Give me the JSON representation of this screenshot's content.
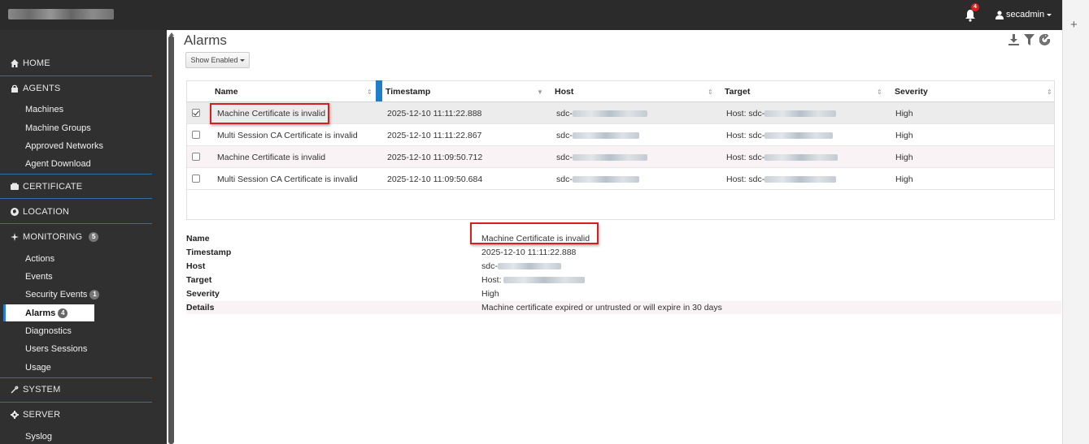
{
  "topbar": {
    "notification_count": "4",
    "username": "secadmin"
  },
  "sidebar": {
    "home": "HOME",
    "agents": "AGENTS",
    "agents_items": [
      "Machines",
      "Machine Groups",
      "Approved Networks",
      "Agent Download"
    ],
    "certificate": "CERTIFICATE",
    "location": "LOCATION",
    "monitoring": "MONITORING",
    "monitoring_count": "5",
    "monitoring_items": [
      "Actions",
      "Events"
    ],
    "security_events": "Security Events",
    "security_events_count": "1",
    "alarms": "Alarms",
    "alarms_count": "4",
    "monitoring_items_after": [
      "Diagnostics",
      "Users Sessions",
      "Usage"
    ],
    "system": "SYSTEM",
    "server": "SERVER",
    "server_items": [
      "Syslog"
    ]
  },
  "page": {
    "title": "Alarms",
    "show_button": "Show Enabled"
  },
  "table": {
    "columns": [
      "Name",
      "Timestamp",
      "Host",
      "Target",
      "Severity"
    ],
    "rows": [
      {
        "checked": true,
        "name": "Machine Certificate is invalid",
        "timestamp": "2025-12-10 11:11:22.888",
        "host": "sdc-",
        "target": "Host: sdc-",
        "severity": "High"
      },
      {
        "checked": false,
        "name": "Multi Session CA Certificate is invalid",
        "timestamp": "2025-12-10 11:11:22.867",
        "host": "sdc-",
        "target": "Host: sdc-",
        "severity": "High"
      },
      {
        "checked": false,
        "name": "Machine Certificate is invalid",
        "timestamp": "2025-12-10 11:09:50.712",
        "host": "sdc-",
        "target": "Host: sdc-",
        "severity": "High"
      },
      {
        "checked": false,
        "name": "Multi Session CA Certificate is invalid",
        "timestamp": "2025-12-10 11:09:50.684",
        "host": "sdc-",
        "target": "Host: sdc-",
        "severity": "High"
      }
    ]
  },
  "details": {
    "labels": [
      "Name",
      "Timestamp",
      "Host",
      "Target",
      "Severity",
      "Details"
    ],
    "name": "Machine Certificate is invalid",
    "timestamp": "2025-12-10 11:11:22.888",
    "host": "sdc-",
    "target": "Host:",
    "severity": "High",
    "details": "Machine certificate expired or untrusted or will expire in 30 days"
  },
  "colors": {
    "topbar": "#2b2b2b",
    "sidebar": "#303030",
    "accent": "#1e7ec8",
    "highlight_box": "#d21f1f"
  },
  "icons": [
    "bell-icon",
    "user-icon",
    "home-icon",
    "lock-icon",
    "certificate-icon",
    "globe-icon",
    "monitoring-icon",
    "wrench-icon",
    "gear-icon",
    "download-icon",
    "filter-icon",
    "refresh-icon"
  ]
}
